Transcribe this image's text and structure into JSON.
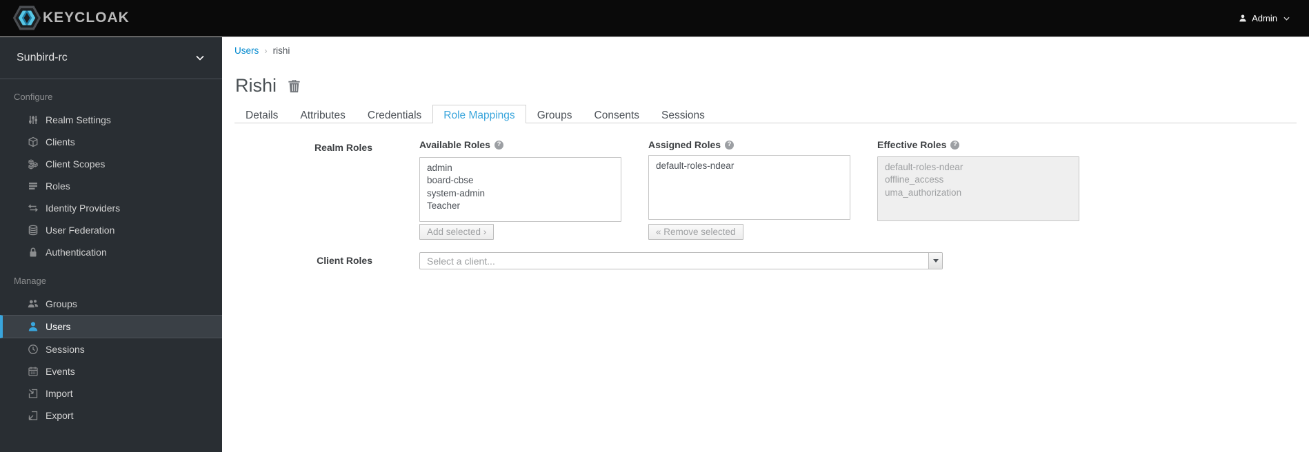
{
  "header": {
    "brand": "KEYCLOAK",
    "user_menu": {
      "label": "Admin"
    }
  },
  "sidebar": {
    "realm_selector": {
      "value": "Sunbird-rc"
    },
    "sections": [
      {
        "label": "Configure",
        "items": [
          {
            "label": "Realm Settings",
            "icon": "sliders-icon",
            "active": false
          },
          {
            "label": "Clients",
            "icon": "cube-icon",
            "active": false
          },
          {
            "label": "Client Scopes",
            "icon": "cubes-icon",
            "active": false
          },
          {
            "label": "Roles",
            "icon": "list-icon",
            "active": false
          },
          {
            "label": "Identity Providers",
            "icon": "exchange-icon",
            "active": false
          },
          {
            "label": "User Federation",
            "icon": "database-icon",
            "active": false
          },
          {
            "label": "Authentication",
            "icon": "lock-icon",
            "active": false
          }
        ]
      },
      {
        "label": "Manage",
        "items": [
          {
            "label": "Groups",
            "icon": "group-icon",
            "active": false
          },
          {
            "label": "Users",
            "icon": "user-icon",
            "active": true
          },
          {
            "label": "Sessions",
            "icon": "clock-icon",
            "active": false
          },
          {
            "label": "Events",
            "icon": "calendar-icon",
            "active": false
          },
          {
            "label": "Import",
            "icon": "import-icon",
            "active": false
          },
          {
            "label": "Export",
            "icon": "export-icon",
            "active": false
          }
        ]
      }
    ]
  },
  "main": {
    "breadcrumb": {
      "link": "Users",
      "separator": "›",
      "current": "rishi"
    },
    "page_title": "Rishi",
    "tabs": [
      {
        "label": "Details",
        "active": false
      },
      {
        "label": "Attributes",
        "active": false
      },
      {
        "label": "Credentials",
        "active": false
      },
      {
        "label": "Role Mappings",
        "active": true
      },
      {
        "label": "Groups",
        "active": false
      },
      {
        "label": "Consents",
        "active": false
      },
      {
        "label": "Sessions",
        "active": false
      }
    ],
    "form": {
      "realm_roles_label": "Realm Roles",
      "client_roles_label": "Client Roles",
      "help_glyph": "?",
      "available": {
        "header": "Available Roles",
        "items": [
          "admin",
          "board-cbse",
          "system-admin",
          "Teacher"
        ],
        "button": "Add selected ›"
      },
      "assigned": {
        "header": "Assigned Roles",
        "items": [
          "default-roles-ndear"
        ],
        "button": "« Remove selected"
      },
      "effective": {
        "header": "Effective Roles",
        "items": [
          "default-roles-ndear",
          "offline_access",
          "uma_authorization"
        ]
      },
      "client_select": {
        "placeholder": "Select a client..."
      }
    }
  },
  "colors": {
    "header_bg": "#0a0a0a",
    "sidebar_bg": "#292e33",
    "active_item_bg": "#3a4046",
    "accent_blue": "#39a5dc",
    "link_blue": "#0088ce",
    "text_dark": "#4d5258",
    "disabled_text": "#9d9fa1"
  }
}
